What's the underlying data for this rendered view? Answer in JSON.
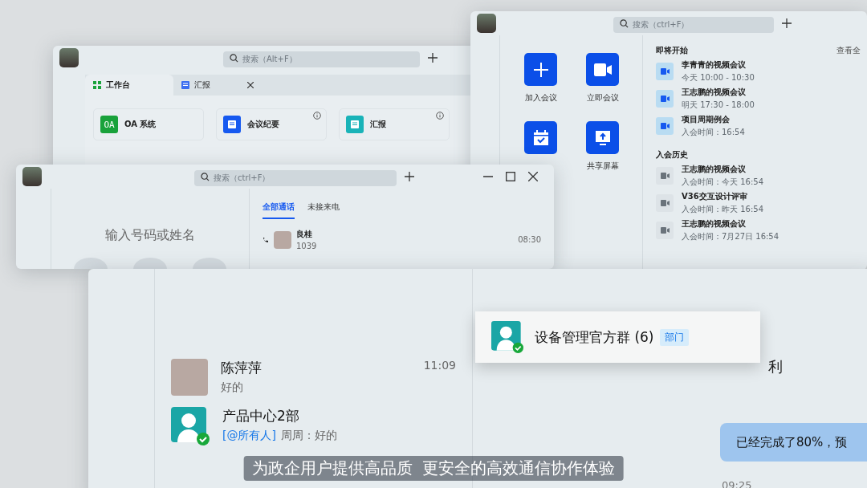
{
  "workbench_window": {
    "search": {
      "placeholder": "搜索（Alt+F）"
    },
    "tabs": [
      {
        "label": "工作台",
        "selected": true,
        "kind": "grid",
        "closable": false
      },
      {
        "label": "汇报",
        "selected": false,
        "kind": "doc",
        "closable": true
      }
    ],
    "apps": [
      {
        "name": "OA 系统",
        "icon_text": "OA",
        "color": "#19a23b",
        "info": false
      },
      {
        "name": "会议纪要",
        "color": "#1659f0",
        "info": true
      },
      {
        "name": "汇报",
        "color": "#19b3b8",
        "info": true
      }
    ]
  },
  "meeting_window": {
    "search": {
      "placeholder": "搜索（ctrl+F）"
    },
    "actions": [
      {
        "label": "加入会议",
        "kind": "plus"
      },
      {
        "label": "立即会议",
        "kind": "video"
      },
      {
        "kind": "calendar"
      },
      {
        "label": "共享屏幕",
        "kind": "share"
      }
    ],
    "upcoming": {
      "title": "即将开始",
      "link": "查看全",
      "items": [
        {
          "title": "李青青的视频会议",
          "time": "今天 10:00 - 10:30"
        },
        {
          "title": "王志鹏的视频会议",
          "time": "明天 17:30 - 18:00"
        },
        {
          "title": "项目周期例会",
          "time": "入会时间：16:54"
        }
      ]
    },
    "history": {
      "title": "入会历史",
      "items": [
        {
          "title": "王志鹏的视频会议",
          "time": "入会时间：今天 16:54"
        },
        {
          "title": "V36交互设计评审",
          "time": "入会时间：昨天 16:54"
        },
        {
          "title": "王志鹏的视频会议",
          "time": "入会时间：7月27日 16:54"
        }
      ]
    }
  },
  "dialer_window": {
    "search": {
      "placeholder": "搜索（ctrl+F）"
    },
    "dial_input": {
      "placeholder": "输入号码或姓名"
    },
    "tabs": [
      {
        "label": "全部通话",
        "selected": true
      },
      {
        "label": "未接来电",
        "selected": false
      }
    ],
    "calls": [
      {
        "name": "良桂",
        "number": "1039",
        "time": "08:30"
      }
    ]
  },
  "chat_window": {
    "conversations": [
      {
        "name": "陈萍萍",
        "preview": "好的",
        "time": "11:09",
        "kind": "person"
      },
      {
        "name": "产品中心2部",
        "mention": "[@所有人]",
        "preview": "周周：好的",
        "kind": "group"
      }
    ],
    "fragment": "利",
    "message": {
      "text": "已经完成了80%，预",
      "time": "09:25"
    }
  },
  "group_popup": {
    "name": "设备管理官方群 (6)",
    "tag": "部门"
  },
  "caption": "为政企用户提供高品质  更安全的高效通信协作体验"
}
